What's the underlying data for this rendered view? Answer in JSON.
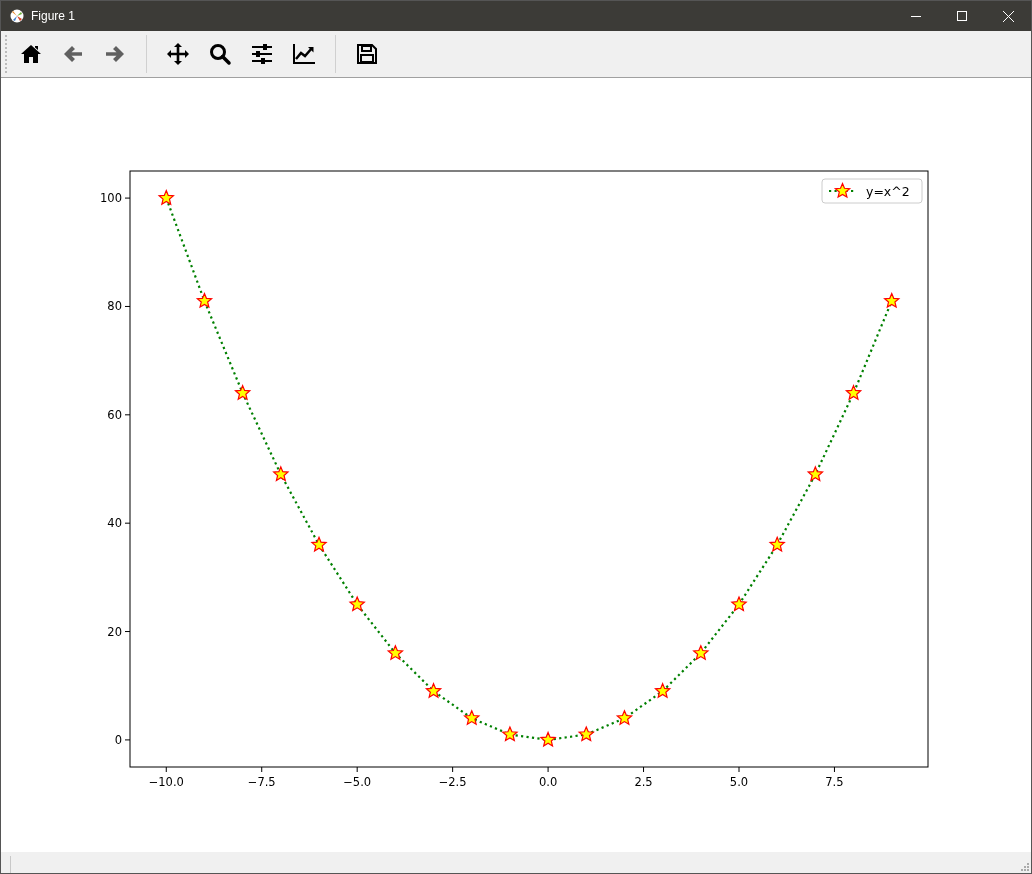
{
  "window": {
    "title": "Figure 1"
  },
  "toolbar": {
    "groups": [
      [
        {
          "kind": "home",
          "disabled": false
        },
        {
          "kind": "back",
          "disabled": true
        },
        {
          "kind": "forward",
          "disabled": true
        }
      ],
      [
        {
          "kind": "pan",
          "disabled": false
        },
        {
          "kind": "zoom",
          "disabled": false
        },
        {
          "kind": "configure",
          "disabled": false
        },
        {
          "kind": "edit",
          "disabled": false
        }
      ],
      [
        {
          "kind": "save",
          "disabled": false
        }
      ]
    ]
  },
  "figure": {
    "chart_data": {
      "type": "line",
      "x": [
        -10,
        -9,
        -8,
        -7,
        -6,
        -5,
        -4,
        -3,
        -2,
        -1,
        0,
        1,
        2,
        3,
        4,
        5,
        6,
        7,
        8,
        9
      ],
      "series": [
        {
          "name": "y=x^2",
          "color": "#008000",
          "line_style": "dotted",
          "marker": "star",
          "values": [
            100,
            81,
            64,
            49,
            36,
            25,
            16,
            9,
            4,
            1,
            0,
            1,
            4,
            9,
            16,
            25,
            36,
            49,
            64,
            81
          ]
        }
      ],
      "xlim": [
        -10.95,
        9.95
      ],
      "ylim": [
        -5,
        105
      ],
      "xticks": [
        {
          "value": -10,
          "label": "−10.0"
        },
        {
          "value": -7.5,
          "label": "−7.5"
        },
        {
          "value": -5,
          "label": "−5.0"
        },
        {
          "value": -2.5,
          "label": "−2.5"
        },
        {
          "value": 0,
          "label": "0.0"
        },
        {
          "value": 2.5,
          "label": "2.5"
        },
        {
          "value": 5,
          "label": "5.0"
        },
        {
          "value": 7.5,
          "label": "7.5"
        }
      ],
      "yticks": [
        0,
        20,
        40,
        60,
        80,
        100
      ]
    }
  }
}
